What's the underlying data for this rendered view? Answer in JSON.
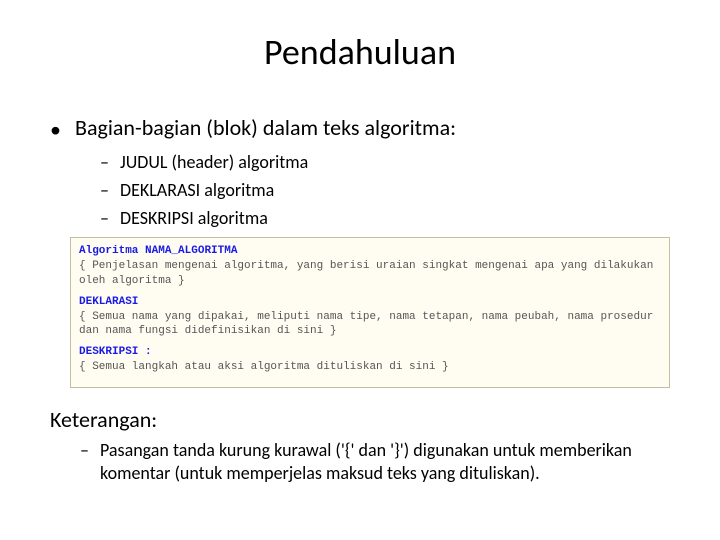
{
  "title": "Pendahuluan",
  "main_bullet": "Bagian-bagian (blok) dalam teks algoritma:",
  "sub_bullets": [
    "JUDUL (header) algoritma",
    "DEKLARASI algoritma",
    "DESKRIPSI algoritma"
  ],
  "code": {
    "kw_algoritma": "Algoritma",
    "kw_nama": "NAMA_ALGORITMA",
    "line1": "{ Penjelasan mengenai algoritma, yang berisi uraian singkat mengenai apa yang dilakukan oleh algoritma }",
    "kw_deklarasi": "DEKLARASI",
    "line2": "{ Semua nama yang dipakai, meliputi nama tipe, nama tetapan, nama peubah, nama prosedur dan nama fungsi didefinisikan di sini }",
    "kw_deskripsi": "DESKRIPSI :",
    "line3": "{ Semua langkah atau aksi algoritma dituliskan di sini }"
  },
  "keterangan_head": "Keterangan:",
  "keterangan_item": "Pasangan tanda kurung kurawal ('{' dan '}') digunakan untuk memberikan komentar (untuk memperjelas maksud teks yang dituliskan)."
}
